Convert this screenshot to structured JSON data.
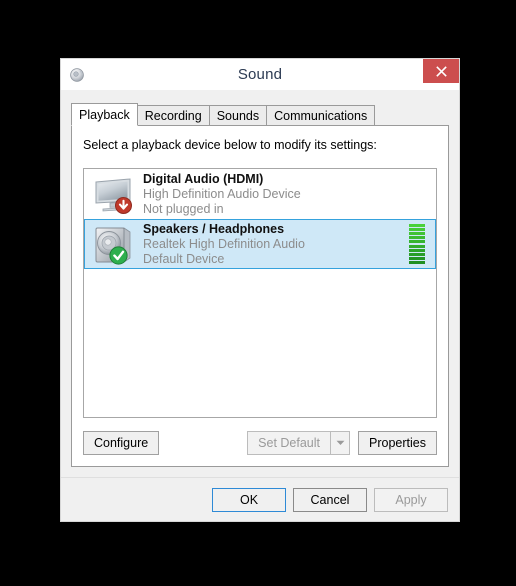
{
  "window": {
    "title": "Sound",
    "icon": "speaker-icon",
    "close_label": "×"
  },
  "tabs": [
    {
      "label": "Playback",
      "active": true
    },
    {
      "label": "Recording",
      "active": false
    },
    {
      "label": "Sounds",
      "active": false
    },
    {
      "label": "Communications",
      "active": false
    }
  ],
  "panel": {
    "prompt": "Select a playback device below to modify its settings:"
  },
  "devices": [
    {
      "name": "Digital Audio (HDMI)",
      "driver": "High Definition Audio Device",
      "status": "Not plugged in",
      "icon": "monitor-icon",
      "badge": "red-down-arrow-badge",
      "selected": false,
      "meter": null
    },
    {
      "name": "Speakers / Headphones",
      "driver": "Realtek High Definition Audio",
      "status": "Default Device",
      "icon": "speaker-box-icon",
      "badge": "green-check-badge",
      "selected": true,
      "meter": {
        "segments": 10,
        "lit": 10
      }
    }
  ],
  "buttons": {
    "configure": {
      "label": "Configure",
      "disabled": false
    },
    "set_default": {
      "label": "Set Default",
      "disabled": true,
      "has_dropdown": true
    },
    "properties": {
      "label": "Properties",
      "disabled": false
    },
    "ok": {
      "label": "OK",
      "disabled": false,
      "default": true
    },
    "cancel": {
      "label": "Cancel",
      "disabled": false
    },
    "apply": {
      "label": "Apply",
      "disabled": true
    }
  },
  "colors": {
    "selection_fill": "#cfe8f7",
    "selection_border": "#35a2dd",
    "close_button": "#cc4e4e",
    "meter_top": "#49d13a",
    "meter_bottom": "#1f8f22",
    "title_text": "#2b3a52",
    "sub_text": "#8c8c8c",
    "focus_border": "#2e8ad6"
  }
}
